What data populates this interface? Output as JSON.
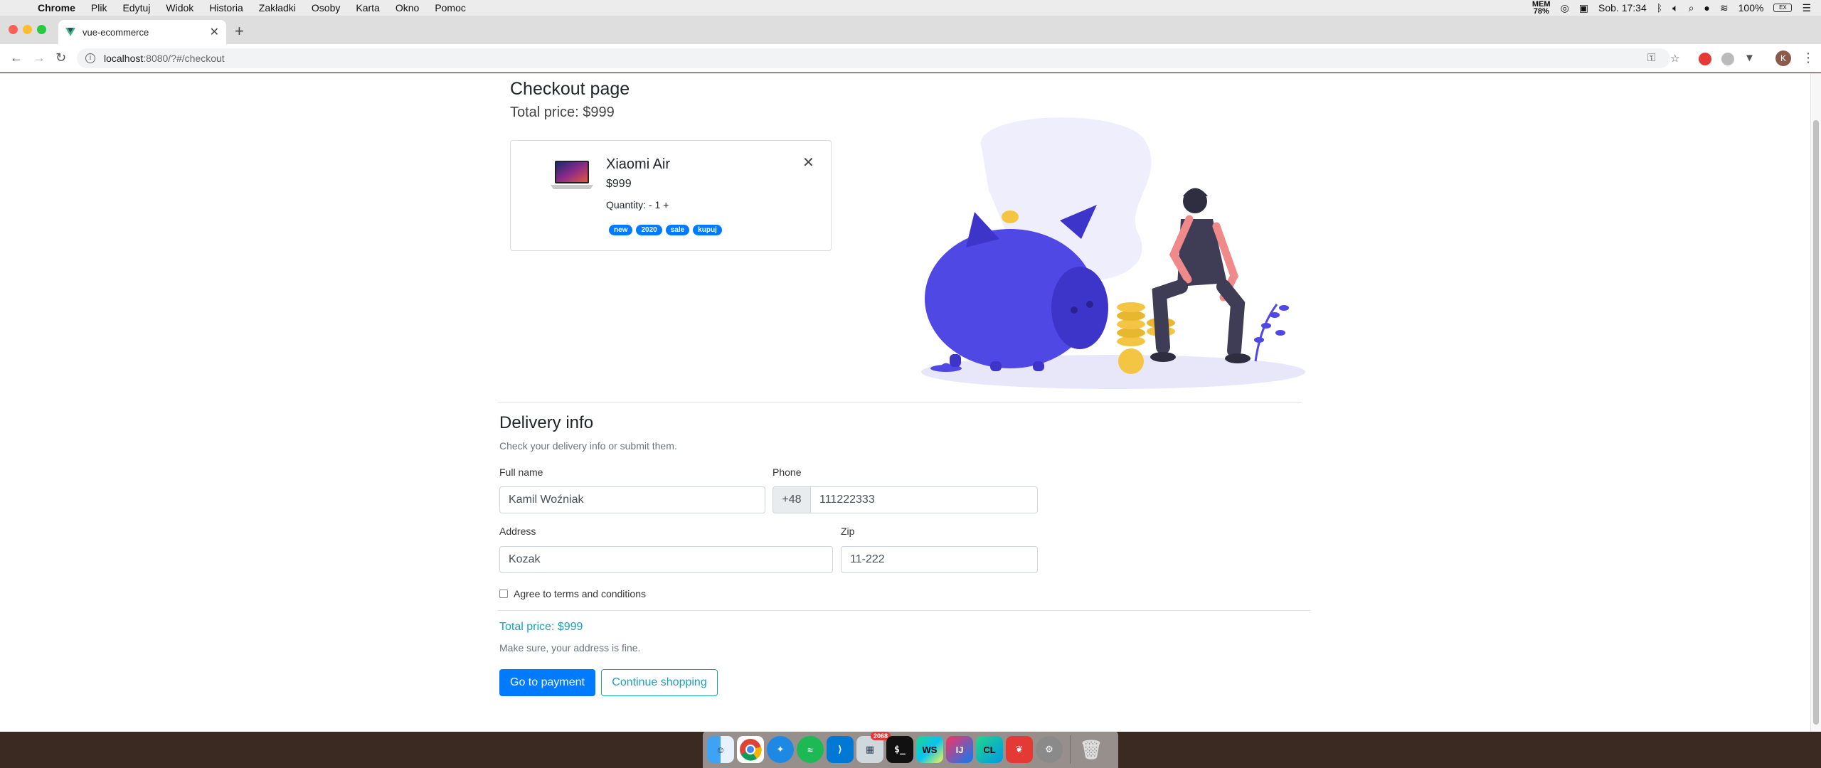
{
  "menubar": {
    "app_name": "Chrome",
    "items": [
      "Plik",
      "Edytuj",
      "Widok",
      "Historia",
      "Zakładki",
      "Osoby",
      "Karta",
      "Okno",
      "Pomoc"
    ],
    "mem_label": "MEM",
    "mem_value": "78%",
    "clock": "Sob. 17:34",
    "battery_percent": "100%",
    "battery_box": "EX"
  },
  "browser": {
    "tab_title": "vue-ecommerce",
    "tab_close": "✕",
    "new_tab": "+",
    "url_host": "localhost",
    "url_rest": ":8080/?#/checkout",
    "profile_initial": "K"
  },
  "checkout": {
    "title": "Checkout page",
    "total_price": "Total price: $999"
  },
  "product": {
    "name": "Xiaomi Air",
    "price": "$999",
    "quantity": "Quantity: - 1 +",
    "remove": "✕",
    "tags": [
      "new",
      "2020",
      "sale",
      "kupuj"
    ]
  },
  "delivery": {
    "title": "Delivery info",
    "subtitle": "Check your delivery info or submit them.",
    "fullname_label": "Full name",
    "fullname_value": "Kamil Woźniak",
    "phone_label": "Phone",
    "phone_prefix": "+48",
    "phone_value": "111222333",
    "address_label": "Address",
    "address_value": "Kozak",
    "zip_label": "Zip",
    "zip_value": "11-222",
    "agree_label": "Agree to terms and conditions",
    "agree_checked": false
  },
  "summary": {
    "total_price": "Total price: $999",
    "note": "Make sure, your address is fine.",
    "payment_button": "Go to payment",
    "continue_button": "Continue shopping"
  },
  "colors": {
    "primary": "#007bff",
    "info": "#17a2b8",
    "illustration_purple": "#5048e5",
    "illustration_bg": "#efeefd"
  },
  "dock": {
    "badge": "2068",
    "apps": [
      "finder",
      "chrome",
      "safari",
      "spotify",
      "vscode",
      "preview",
      "terminal",
      "webstorm",
      "intellij",
      "clion",
      "paw",
      "system-preferences",
      "trash"
    ]
  }
}
